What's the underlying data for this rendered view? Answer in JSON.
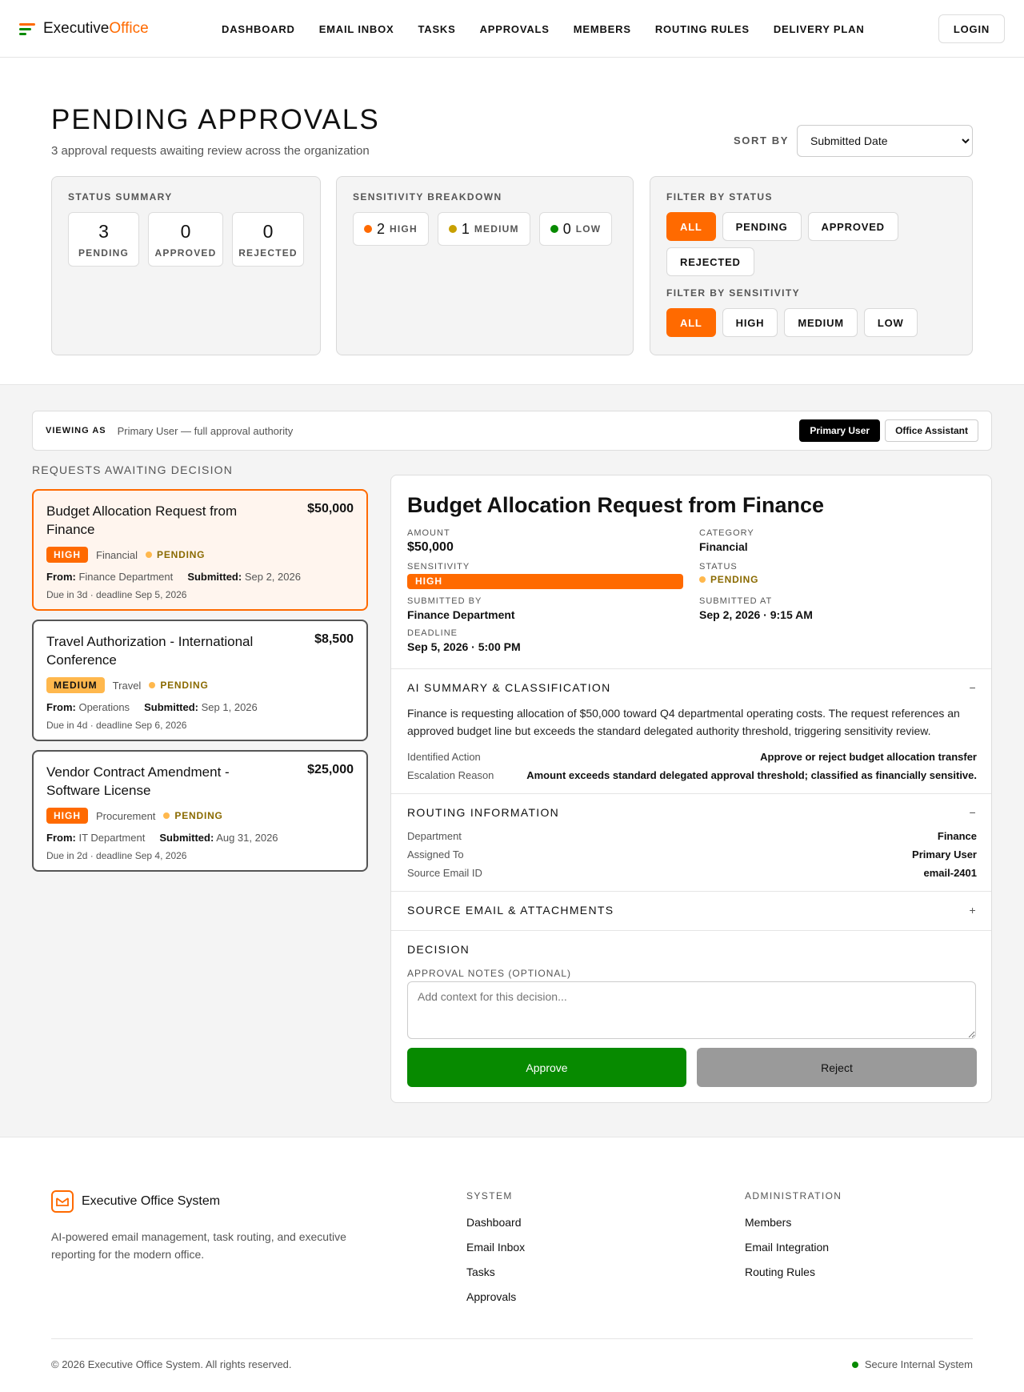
{
  "nav": {
    "brand_main": "Executive",
    "brand_accent": "Office",
    "links": [
      "DASHBOARD",
      "EMAIL INBOX",
      "TASKS",
      "APPROVALS",
      "MEMBERS",
      "ROUTING RULES",
      "DELIVERY PLAN"
    ],
    "login": "LOGIN"
  },
  "header": {
    "title": "PENDING APPROVALS",
    "subtitle": "3 approval requests awaiting review across the organization",
    "sort_label": "SORT BY",
    "sort_value": "Submitted Date"
  },
  "status_summary": {
    "title": "STATUS SUMMARY",
    "items": [
      {
        "num": "3",
        "label": "PENDING"
      },
      {
        "num": "0",
        "label": "APPROVED"
      },
      {
        "num": "0",
        "label": "REJECTED"
      }
    ]
  },
  "sensitivity": {
    "title": "SENSITIVITY BREAKDOWN",
    "items": [
      {
        "num": "2",
        "label": "HIGH",
        "color": "#ff6a00"
      },
      {
        "num": "1",
        "label": "MEDIUM",
        "color": "#c8a000"
      },
      {
        "num": "0",
        "label": "LOW",
        "color": "#078a00"
      }
    ]
  },
  "filters": {
    "status_title": "FILTER BY STATUS",
    "status": [
      "ALL",
      "PENDING",
      "APPROVED",
      "REJECTED"
    ],
    "sensitivity_title": "FILTER BY SENSITIVITY",
    "sensitivity": [
      "ALL",
      "HIGH",
      "MEDIUM",
      "LOW"
    ]
  },
  "viewing": {
    "label": "VIEWING AS",
    "desc": "Primary User — full approval authority",
    "roles": [
      "Primary User",
      "Office Assistant"
    ]
  },
  "list": {
    "title": "REQUESTS AWAITING DECISION",
    "requests": [
      {
        "title": "Budget Allocation Request from Finance",
        "amount": "$50,000",
        "sensitivity": "HIGH",
        "category": "Financial",
        "status": "PENDING",
        "from_label": "From:",
        "from": "Finance Department",
        "submitted_label": "Submitted:",
        "submitted": "Sep 2, 2026",
        "due": "Due in 3d · deadline Sep 5, 2026"
      },
      {
        "title": "Travel Authorization - International Conference",
        "amount": "$8,500",
        "sensitivity": "MEDIUM",
        "category": "Travel",
        "status": "PENDING",
        "from_label": "From:",
        "from": "Operations",
        "submitted_label": "Submitted:",
        "submitted": "Sep 1, 2026",
        "due": "Due in 4d · deadline Sep 6, 2026"
      },
      {
        "title": "Vendor Contract Amendment - Software License",
        "amount": "$25,000",
        "sensitivity": "HIGH",
        "category": "Procurement",
        "status": "PENDING",
        "from_label": "From:",
        "from": "IT Department",
        "submitted_label": "Submitted:",
        "submitted": "Aug 31, 2026",
        "due": "Due in 2d · deadline Sep 4, 2026"
      }
    ]
  },
  "detail": {
    "title": "Budget Allocation Request from Finance",
    "amount_label": "AMOUNT",
    "amount": "$50,000",
    "category_label": "CATEGORY",
    "category": "Financial",
    "sensitivity_label": "SENSITIVITY",
    "sensitivity": "HIGH",
    "status_label": "STATUS",
    "status": "PENDING",
    "submitted_by_label": "SUBMITTED BY",
    "submitted_by": "Finance Department",
    "submitted_at_label": "SUBMITTED AT",
    "submitted_at": "Sep 2, 2026 · 9:15 AM",
    "deadline_label": "DEADLINE",
    "deadline": "Sep 5, 2026 · 5:00 PM",
    "ai": {
      "title": "AI SUMMARY & CLASSIFICATION",
      "toggle": "−",
      "summary": "Finance is requesting allocation of $50,000 toward Q4 departmental operating costs. The request references an approved budget line but exceeds the standard delegated authority threshold, triggering sensitivity review.",
      "action_label": "Identified Action",
      "action": "Approve or reject budget allocation transfer",
      "escalation_label": "Escalation Reason",
      "escalation": "Amount exceeds standard delegated approval threshold; classified as financially sensitive."
    },
    "routing": {
      "title": "ROUTING INFORMATION",
      "toggle": "−",
      "dept_label": "Department",
      "dept": "Finance",
      "assigned_label": "Assigned To",
      "assigned": "Primary User",
      "email_label": "Source Email ID",
      "email": "email-2401"
    },
    "source": {
      "title": "SOURCE EMAIL & ATTACHMENTS",
      "toggle": "+"
    },
    "decision": {
      "title": "DECISION",
      "notes_label": "APPROVAL NOTES (OPTIONAL)",
      "notes_placeholder": "Add context for this decision...",
      "approve": "Approve",
      "reject": "Reject"
    }
  },
  "footer": {
    "name": "Executive Office System",
    "desc": "AI-powered email management, task routing, and executive reporting for the modern office.",
    "system_title": "SYSTEM",
    "system_links": [
      "Dashboard",
      "Email Inbox",
      "Tasks",
      "Approvals"
    ],
    "admin_title": "ADMINISTRATION",
    "admin_links": [
      "Members",
      "Email Integration",
      "Routing Rules"
    ],
    "copyright": "© 2026 Executive Office System. All rights reserved.",
    "secure": "Secure Internal System"
  }
}
